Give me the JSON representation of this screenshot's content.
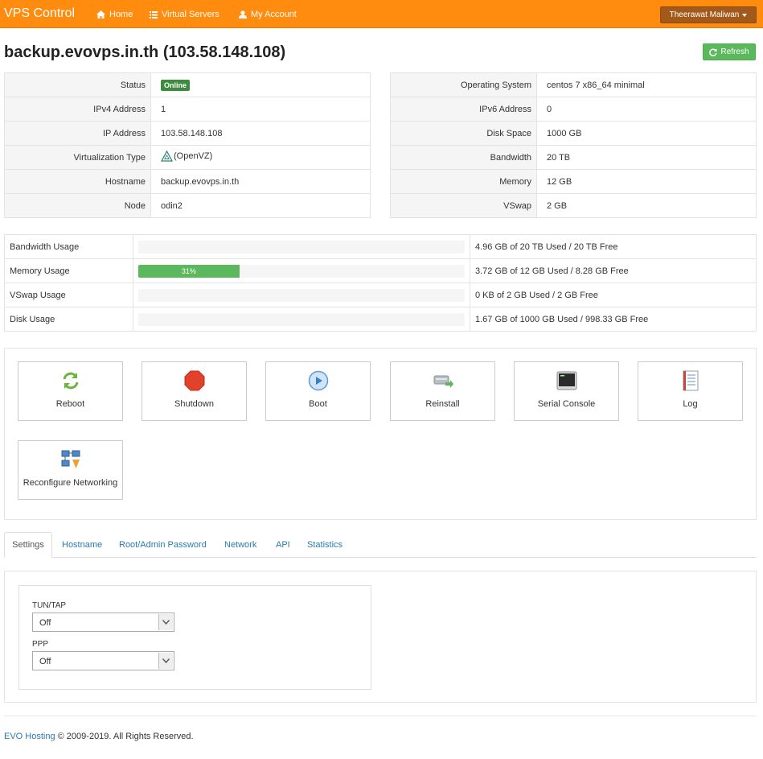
{
  "nav": {
    "brand": "VPS Control",
    "links": [
      {
        "label": "Home",
        "icon": "home-icon"
      },
      {
        "label": "Virtual Servers",
        "icon": "list-icon"
      },
      {
        "label": "My Account",
        "icon": "user-icon"
      }
    ],
    "user": "Theerawat Maliwan"
  },
  "header": {
    "title": "backup.evovps.in.th (103.58.148.108)",
    "refresh_label": "Refresh"
  },
  "info_left": [
    {
      "key": "Status",
      "value": "Online"
    },
    {
      "key": "IPv4 Address",
      "value": "1"
    },
    {
      "key": "IP Address",
      "value": "103.58.148.108"
    },
    {
      "key": "Virtualization Type",
      "value": "(OpenVZ)"
    },
    {
      "key": "Hostname",
      "value": "backup.evovps.in.th"
    },
    {
      "key": "Node",
      "value": "odin2"
    }
  ],
  "info_right": [
    {
      "key": "Operating System",
      "value": "centos 7 x86_64 minimal"
    },
    {
      "key": "IPv6 Address",
      "value": "0"
    },
    {
      "key": "Disk Space",
      "value": "1000 GB"
    },
    {
      "key": "Bandwidth",
      "value": "20 TB"
    },
    {
      "key": "Memory",
      "value": "12 GB"
    },
    {
      "key": "VSwap",
      "value": "2 GB"
    }
  ],
  "usage": [
    {
      "label": "Bandwidth Usage",
      "percent": 0,
      "percent_label": "",
      "detail": "4.96 GB of 20 TB Used / 20 TB Free"
    },
    {
      "label": "Memory Usage",
      "percent": 31,
      "percent_label": "31%",
      "detail": "3.72 GB of 12 GB Used / 8.28 GB Free"
    },
    {
      "label": "VSwap Usage",
      "percent": 0,
      "percent_label": "",
      "detail": "0 KB of 2 GB Used / 2 GB Free"
    },
    {
      "label": "Disk Usage",
      "percent": 0,
      "percent_label": "",
      "detail": "1.67 GB of 1000 GB Used / 998.33 GB Free"
    }
  ],
  "actions": [
    {
      "label": "Reboot",
      "icon": "reboot-icon"
    },
    {
      "label": "Shutdown",
      "icon": "shutdown-icon"
    },
    {
      "label": "Boot",
      "icon": "boot-icon"
    },
    {
      "label": "Reinstall",
      "icon": "reinstall-icon"
    },
    {
      "label": "Serial Console",
      "icon": "console-icon"
    },
    {
      "label": "Log",
      "icon": "log-icon"
    },
    {
      "label": "Reconfigure Networking",
      "icon": "network-icon"
    }
  ],
  "tabs": [
    "Settings",
    "Hostname",
    "Root/Admin Password",
    "Network",
    "API",
    "Statistics"
  ],
  "settings": {
    "tuntap_label": "TUN/TAP",
    "tuntap_value": "Off",
    "ppp_label": "PPP",
    "ppp_value": "Off"
  },
  "footer": {
    "link": "EVO Hosting",
    "text": " © 2009-2019. All Rights Reserved."
  },
  "colors": {
    "navbar": "#ff8c0f",
    "online": "#3d8b3d",
    "progress": "#5cb85c",
    "link": "#2a7ab0"
  }
}
